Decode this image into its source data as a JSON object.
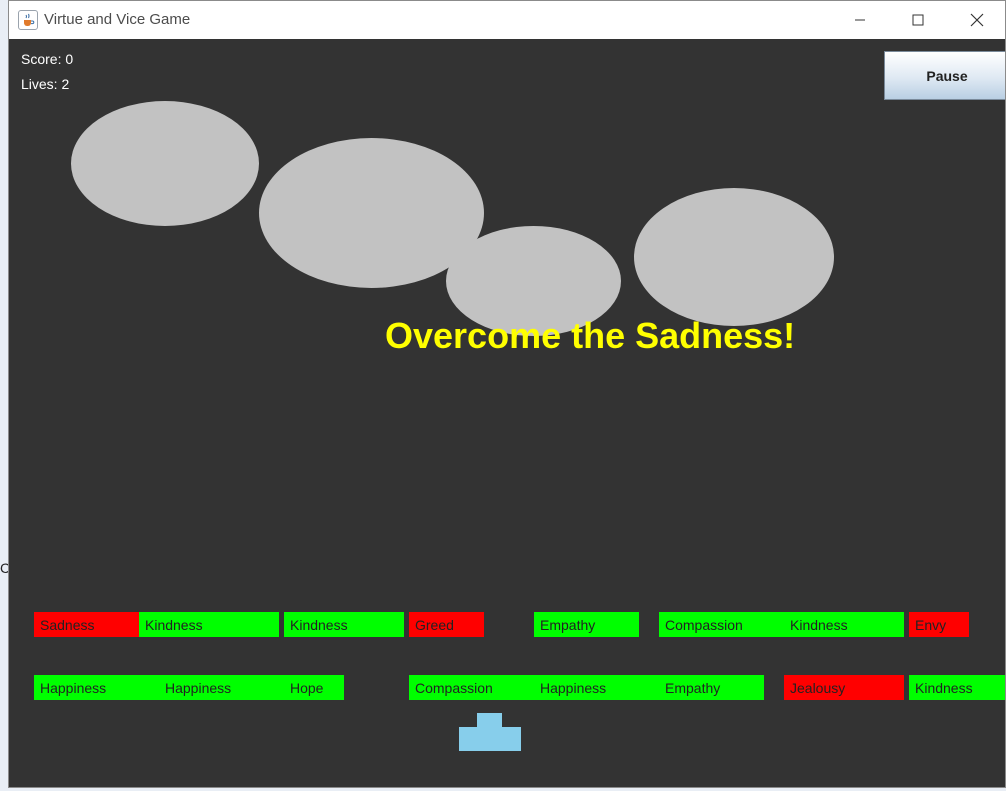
{
  "window": {
    "title": "Virtue and Vice Game",
    "icons": {
      "app": "java-coffee-cup-icon",
      "minimize": "minimize-icon",
      "maximize": "maximize-icon",
      "close": "close-icon"
    }
  },
  "hud": {
    "score_text": "Score: 0",
    "lives_text": "Lives: 2"
  },
  "pause_label": "Pause",
  "message": "Overcome the Sadness!",
  "colors": {
    "background": "#333333",
    "virtue": "#00ff00",
    "vice": "#ff0000",
    "balls": "#c2c2c2",
    "message": "#ffff00",
    "paddle": "#87ceeb"
  },
  "bricks_row1": [
    {
      "label": "Sadness",
      "kind": "vice"
    },
    {
      "label": "Kindness",
      "kind": "virtue"
    },
    {
      "label": "Kindness",
      "kind": "virtue"
    },
    {
      "label": "Greed",
      "kind": "vice"
    },
    {
      "label": "Empathy",
      "kind": "virtue"
    },
    {
      "label": "Compassion",
      "kind": "virtue"
    },
    {
      "label": "Kindness",
      "kind": "virtue"
    },
    {
      "label": "Envy",
      "kind": "vice"
    }
  ],
  "bricks_row2": [
    {
      "label": "Happiness",
      "kind": "virtue"
    },
    {
      "label": "Happiness",
      "kind": "virtue"
    },
    {
      "label": "Hope",
      "kind": "virtue"
    },
    {
      "label": "Compassion",
      "kind": "virtue"
    },
    {
      "label": "Happiness",
      "kind": "virtue"
    },
    {
      "label": "Empathy",
      "kind": "virtue"
    },
    {
      "label": "Jealousy",
      "kind": "vice"
    },
    {
      "label": "Kindness",
      "kind": "virtue"
    }
  ],
  "stray_text": "C"
}
